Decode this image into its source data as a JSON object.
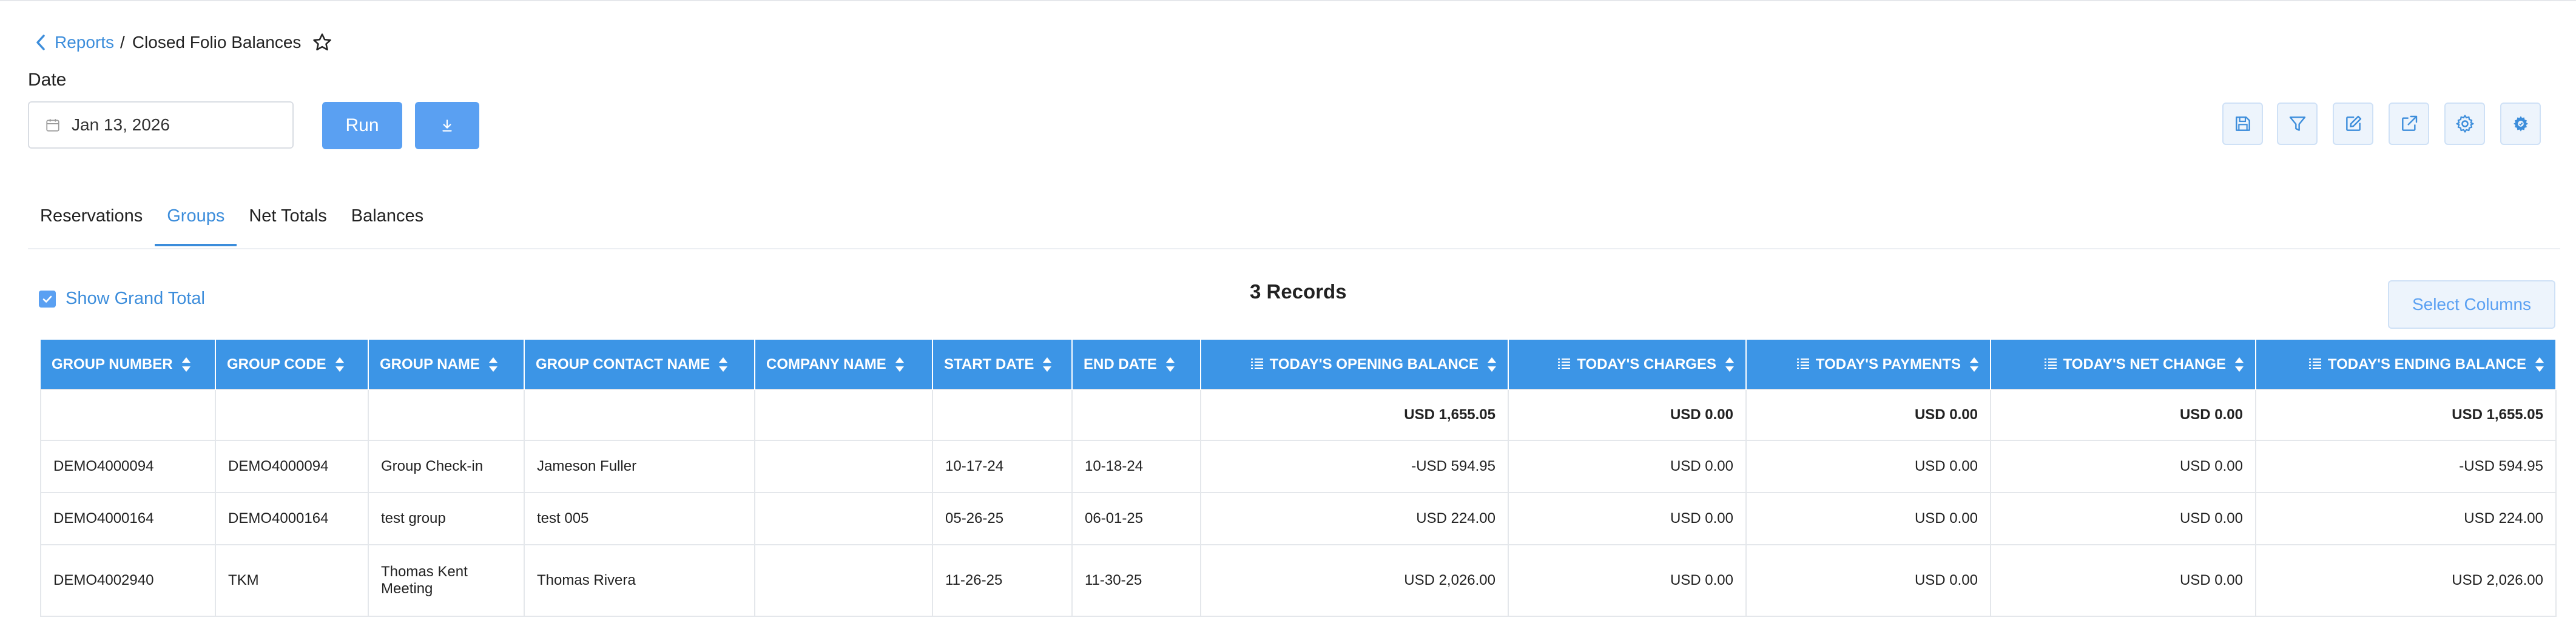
{
  "breadcrumb": {
    "parent": "Reports",
    "separator": "/",
    "current": "Closed Folio Balances"
  },
  "filters": {
    "date_label": "Date",
    "date_value": "Jan 13, 2026"
  },
  "buttons": {
    "run": "Run"
  },
  "toolbar_icons": [
    "save-icon",
    "filter-icon",
    "edit-icon",
    "export-icon",
    "settings-icon",
    "gear-cycle-icon"
  ],
  "tabs": [
    {
      "label": "Reservations",
      "active": false
    },
    {
      "label": "Groups",
      "active": true
    },
    {
      "label": "Net Totals",
      "active": false
    },
    {
      "label": "Balances",
      "active": false
    }
  ],
  "grand_total": {
    "label": "Show Grand Total",
    "checked": true
  },
  "records_count": "3 Records",
  "select_columns": "Select Columns",
  "colors": {
    "accent": "#3c8ddb",
    "header_bg": "#3c95e6",
    "button": "#5aa0f2"
  },
  "table": {
    "columns": [
      "GROUP NUMBER",
      "GROUP CODE",
      "GROUP NAME",
      "GROUP CONTACT NAME",
      "COMPANY NAME",
      "START DATE",
      "END DATE",
      "TODAY'S OPENING BALANCE",
      "TODAY'S CHARGES",
      "TODAY'S PAYMENTS",
      "TODAY'S NET CHANGE",
      "TODAY'S ENDING BALANCE"
    ],
    "totals": [
      "",
      "",
      "",
      "",
      "",
      "",
      "",
      "USD 1,655.05",
      "USD 0.00",
      "USD 0.00",
      "USD 0.00",
      "USD 1,655.05"
    ],
    "rows": [
      [
        "DEMO4000094",
        "DEMO4000094",
        "Group Check-in",
        "Jameson Fuller",
        "",
        "10-17-24",
        "10-18-24",
        "-USD 594.95",
        "USD 0.00",
        "USD 0.00",
        "USD 0.00",
        "-USD 594.95"
      ],
      [
        "DEMO4000164",
        "DEMO4000164",
        "test group",
        "test 005",
        "",
        "05-26-25",
        "06-01-25",
        "USD 224.00",
        "USD 0.00",
        "USD 0.00",
        "USD 0.00",
        "USD 224.00"
      ],
      [
        "DEMO4002940",
        "TKM",
        "Thomas Kent Meeting",
        "Thomas Rivera",
        "",
        "11-26-25",
        "11-30-25",
        "USD 2,026.00",
        "USD 0.00",
        "USD 0.00",
        "USD 0.00",
        "USD 2,026.00"
      ]
    ]
  }
}
